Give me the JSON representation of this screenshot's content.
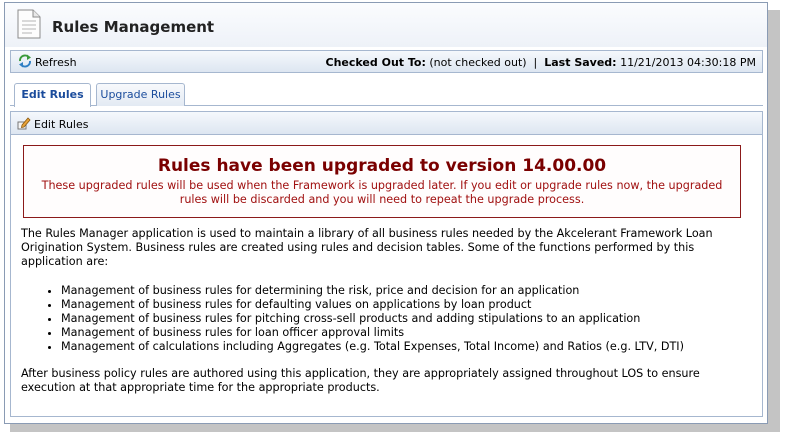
{
  "header": {
    "title": "Rules Management",
    "icon": "document-icon"
  },
  "toolbar": {
    "refresh_label": "Refresh",
    "checked_out_label": "Checked Out To:",
    "checked_out_value": "(not checked out)",
    "last_saved_label": "Last Saved:",
    "last_saved_value": "11/21/2013 04:30:18 PM"
  },
  "tabs": [
    {
      "label": "Edit Rules",
      "active": true
    },
    {
      "label": "Upgrade Rules",
      "active": false
    }
  ],
  "subtoolbar": {
    "edit_rules_label": "Edit Rules"
  },
  "alert": {
    "title": "Rules have been upgraded to version 14.00.00",
    "message": "These upgraded rules will be used when the Framework is upgraded later. If you edit or upgrade rules now, the upgraded rules will be discarded and you will need to repeat the upgrade process."
  },
  "content": {
    "intro": "The Rules Manager application is used to maintain a library of all business rules needed by the Akcelerant Framework Loan Origination System. Business rules are created using rules and decision tables. Some of the functions performed by this application are:",
    "features": [
      "Management of business rules for determining the risk, price and decision for an application",
      "Management of business rules for defaulting values on applications by loan product",
      "Management of business rules for pitching cross-sell products and adding stipulations to an application",
      "Management of business rules for loan officer approval limits",
      "Management of calculations including Aggregates (e.g. Total Expenses, Total Income) and Ratios (e.g. LTV, DTI)"
    ],
    "closing": "After business policy rules are authored using this application, they are appropriately assigned throughout LOS to ensure execution at that appropriate time for the appropriate products."
  },
  "colors": {
    "accent": "#1b4c9c",
    "alert": "#8b1010",
    "border": "#a6b7cf"
  }
}
